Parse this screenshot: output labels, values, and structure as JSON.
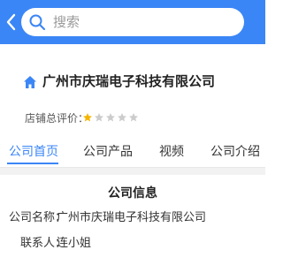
{
  "search": {
    "placeholder": "搜索"
  },
  "company": {
    "name": "广州市庆瑞电子科技有限公司",
    "rating_label": "店铺总评价：",
    "rating_stars": 1,
    "rating_max": 5
  },
  "tabs": [
    {
      "label": "公司首页",
      "active": true
    },
    {
      "label": "公司产品",
      "active": false
    },
    {
      "label": "视频",
      "active": false
    },
    {
      "label": "公司介绍",
      "active": false
    }
  ],
  "info": {
    "title": "公司信息",
    "rows": [
      {
        "label": "公司名称：",
        "value": "广州市庆瑞电子科技有限公司"
      },
      {
        "label": "联系人：",
        "value": "连小姐"
      }
    ]
  },
  "colors": {
    "accent": "#3b86f6",
    "star_on": "#f5b400",
    "star_off": "#cccccc"
  },
  "icons": {
    "back": "chevron-left-icon",
    "search": "search-icon",
    "home": "home-icon",
    "star": "star-icon"
  }
}
